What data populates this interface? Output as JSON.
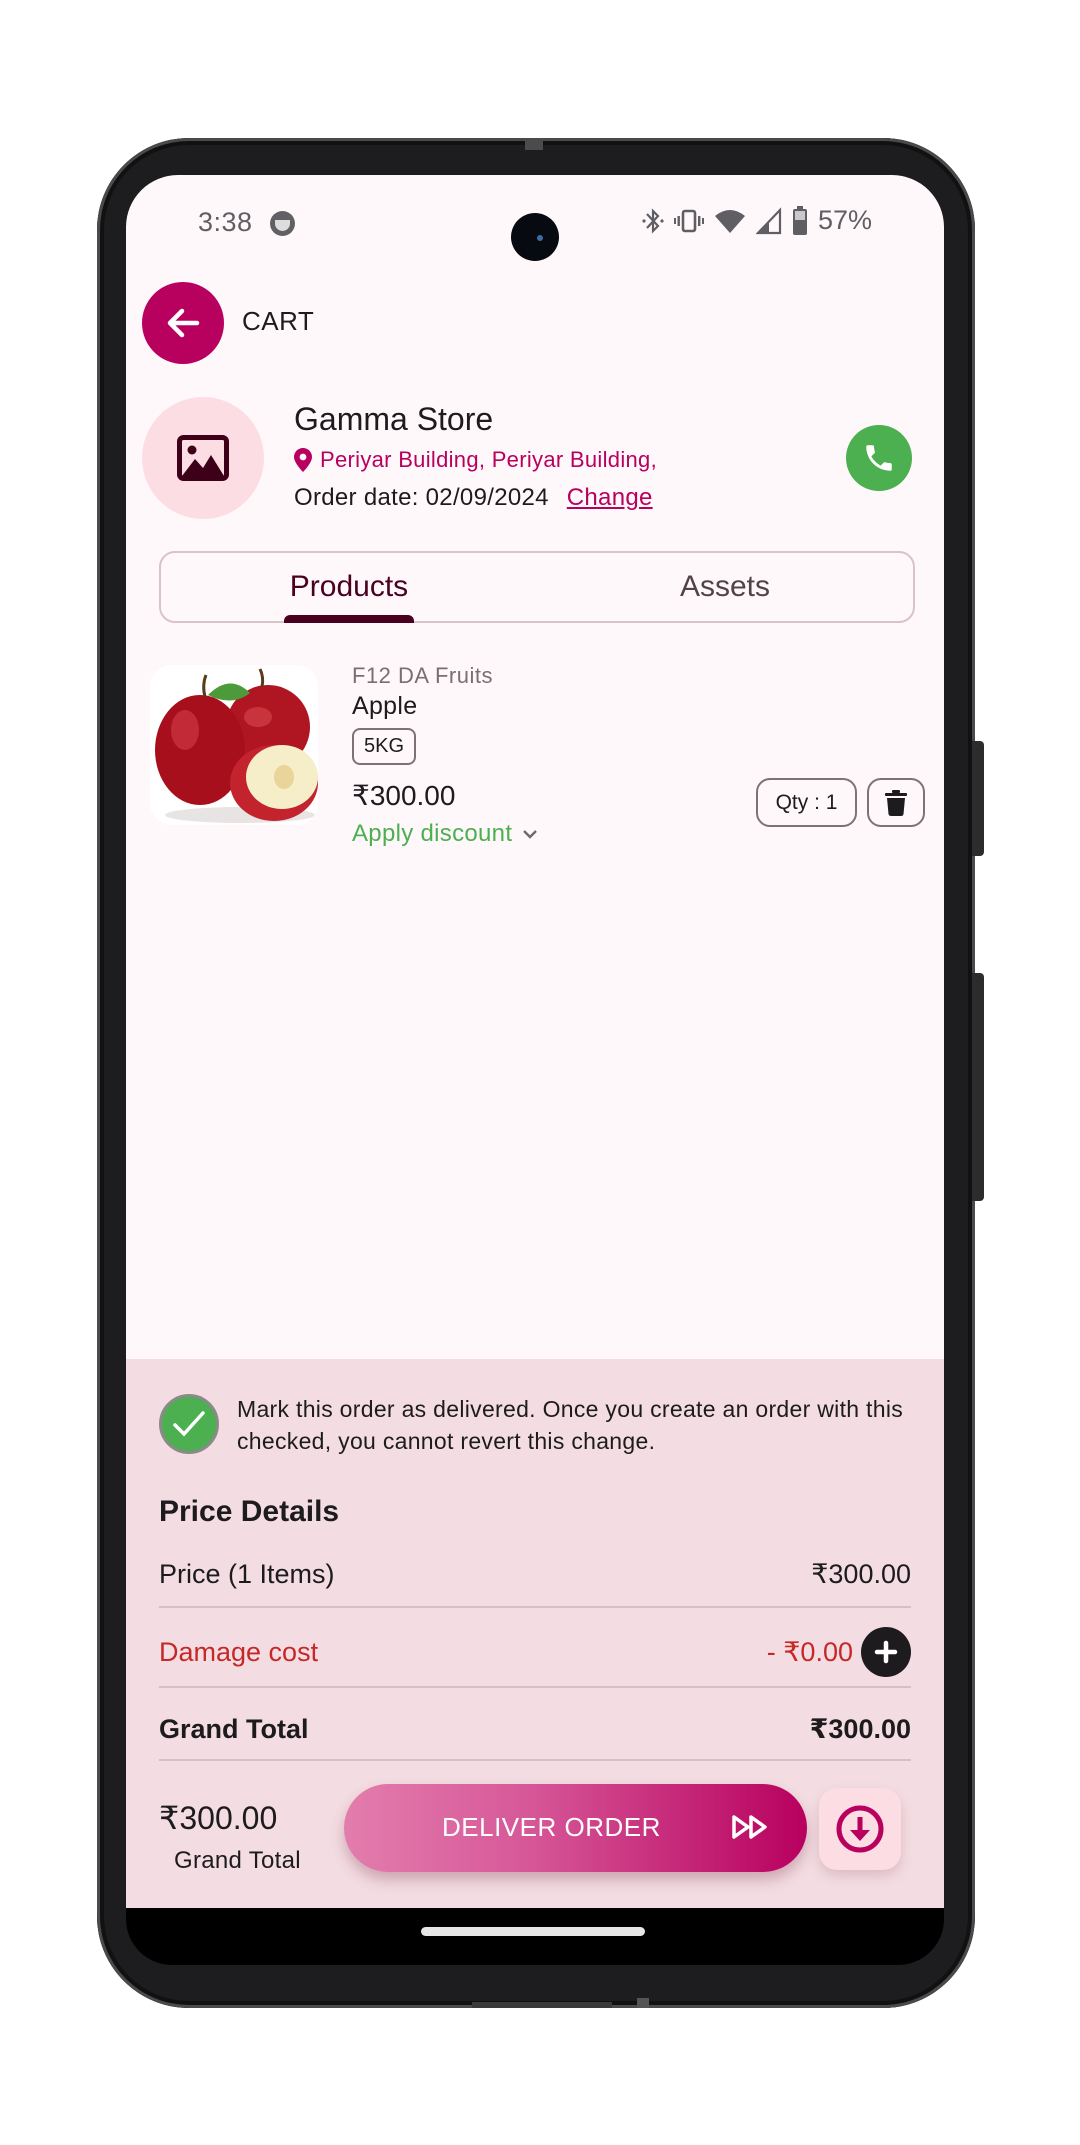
{
  "status_bar": {
    "time": "3:38",
    "battery_percent": "57%",
    "icons": [
      "face-notification-icon",
      "bluetooth-icon",
      "vibrate-icon",
      "wifi-icon",
      "cell-signal-icon",
      "battery-icon"
    ]
  },
  "header": {
    "title": "CART",
    "back_icon": "arrow-left-icon"
  },
  "store": {
    "name": "Gamma Store",
    "address": "Periyar Building, Periyar Building,",
    "order_date_label": "Order date: 02/09/2024",
    "change_label": "Change",
    "avatar_icon": "image-placeholder-icon",
    "call_icon": "phone-icon"
  },
  "tabs": [
    {
      "label": "Products",
      "active": true
    },
    {
      "label": "Assets",
      "active": false
    }
  ],
  "products": [
    {
      "brand": "F12 DA Fruits",
      "name": "Apple",
      "unit": "5KG",
      "price": "₹300.00",
      "discount_label": "Apply discount",
      "qty_label": "Qty : 1"
    }
  ],
  "delivery": {
    "checked": true,
    "text": "Mark this order as delivered. Once you create an order with this checked, you cannot revert this change."
  },
  "price_details": {
    "heading": "Price Details",
    "rows": [
      {
        "label": "Price (1 Items)",
        "value": "₹300.00"
      },
      {
        "label": "Damage cost",
        "value": "- ₹0.00"
      },
      {
        "label": "Grand Total",
        "value": "₹300.00"
      }
    ]
  },
  "footer": {
    "total": "₹300.00",
    "total_label": "Grand Total",
    "deliver_button": "DELIVER ORDER"
  },
  "colors": {
    "primary": "#b8005e",
    "success": "#4caf50",
    "danger": "#c62828",
    "panel_bg": "#f3dde2",
    "app_bg": "#fff8fb"
  }
}
